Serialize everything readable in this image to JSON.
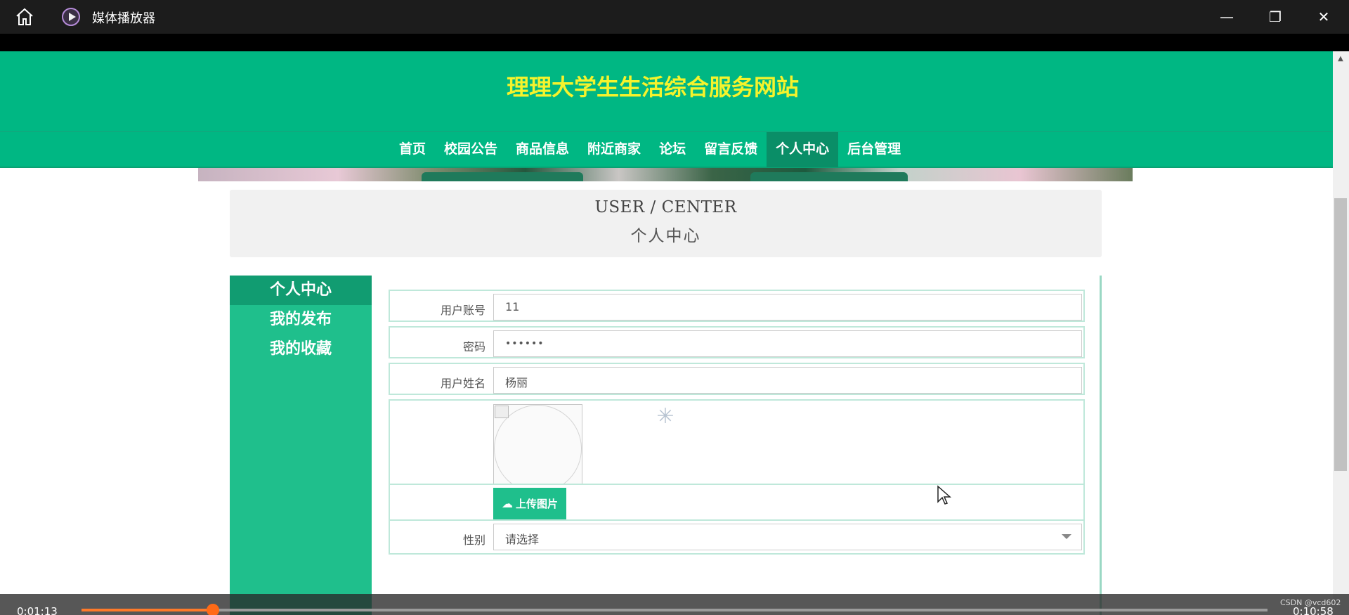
{
  "player": {
    "title": "媒体播放器",
    "minimize_glyph": "—",
    "maximize_glyph": "❐",
    "close_glyph": "✕",
    "current_time": "0:01:13",
    "total_time": "0:10:58",
    "progress": 0.111,
    "watermark": "CSDN @vcd602"
  },
  "site": {
    "title": "理理大学生生活综合服务网站",
    "nav": [
      {
        "label": "首页",
        "active": false
      },
      {
        "label": "校园公告",
        "active": false
      },
      {
        "label": "商品信息",
        "active": false
      },
      {
        "label": "附近商家",
        "active": false
      },
      {
        "label": "论坛",
        "active": false
      },
      {
        "label": "留言反馈",
        "active": false
      },
      {
        "label": "个人中心",
        "active": true
      },
      {
        "label": "后台管理",
        "active": false
      }
    ]
  },
  "user_center": {
    "title_en": "USER / CENTER",
    "title_cn": "个人中心"
  },
  "sidebar": {
    "items": [
      {
        "label": "个人中心",
        "active": true
      },
      {
        "label": "我的发布",
        "active": false
      },
      {
        "label": "我的收藏",
        "active": false
      }
    ]
  },
  "form": {
    "account_label": "用户账号",
    "account_value": "11",
    "password_label": "密码",
    "password_value": "••••••",
    "name_label": "用户姓名",
    "name_value": "杨丽",
    "upload_label": "上传图片",
    "gender_label": "性别",
    "gender_placeholder": "请选择"
  },
  "icons": {
    "home": "home-icon",
    "app": "media-player-icon",
    "upload": "cloud-upload-icon",
    "spinner": "loading-spinner-icon"
  }
}
